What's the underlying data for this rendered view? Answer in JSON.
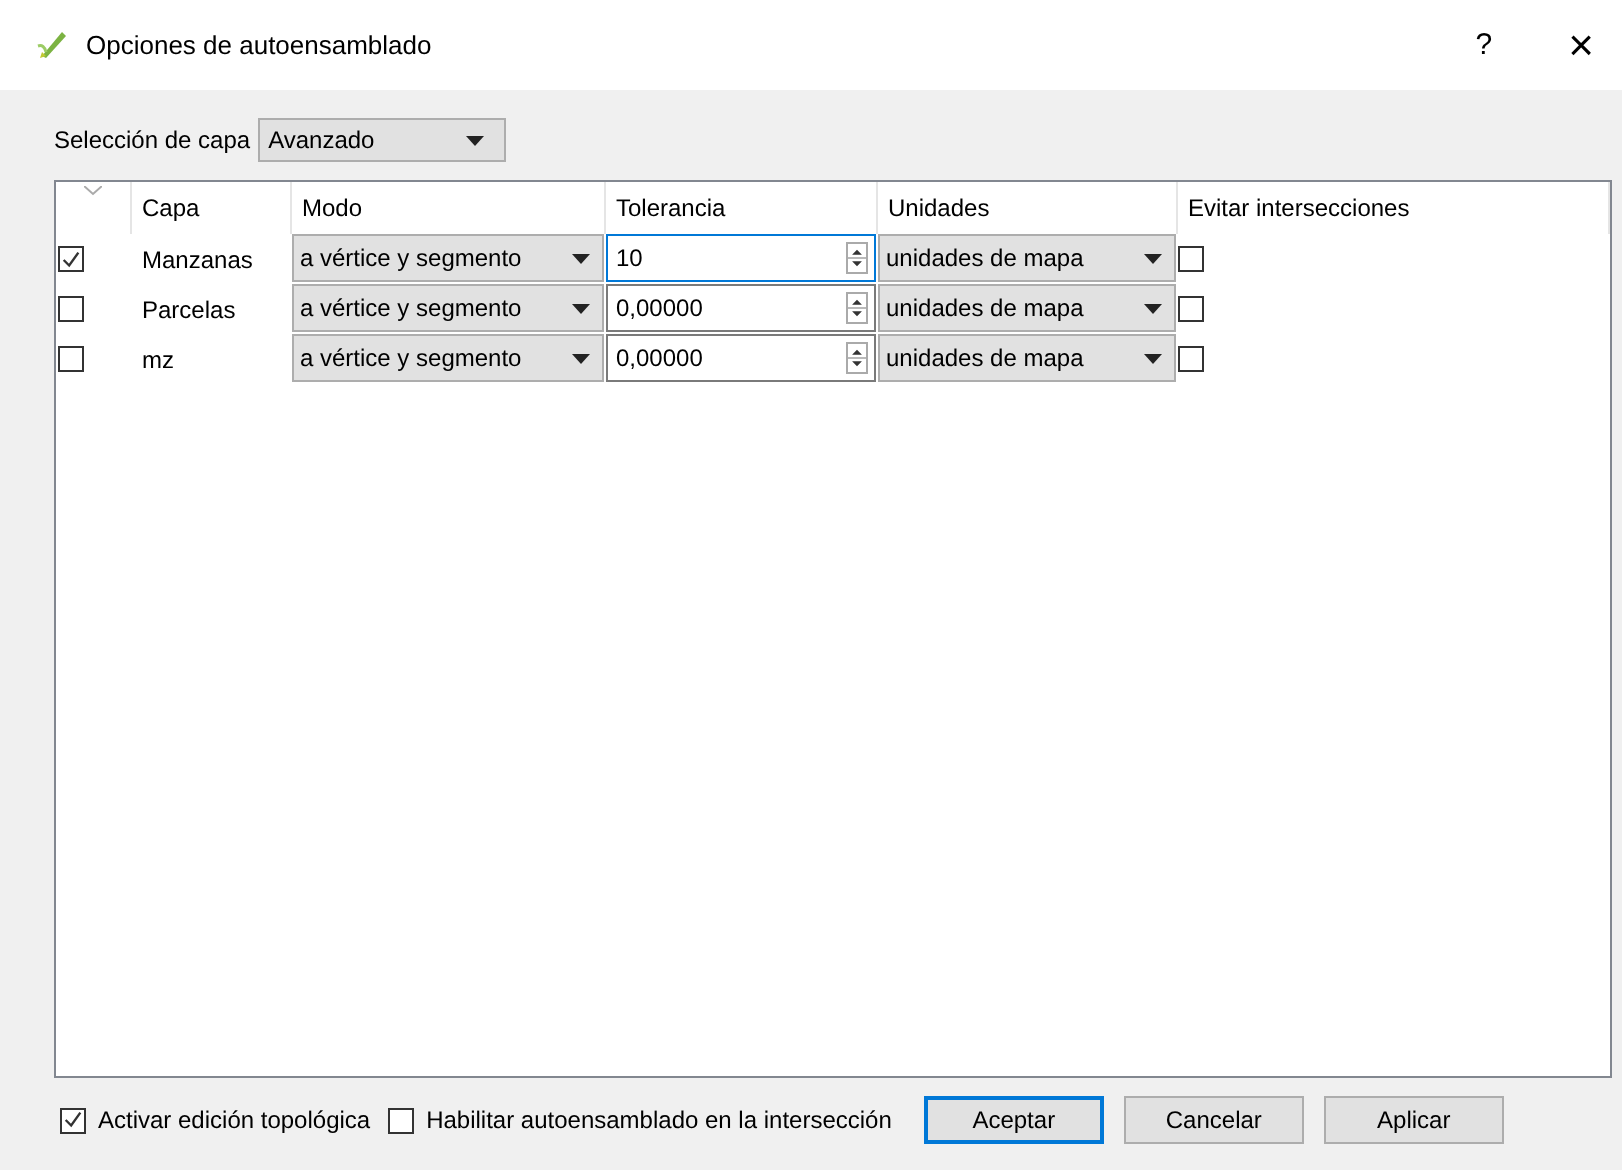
{
  "window": {
    "title": "Opciones de autoensamblado",
    "help": "?",
    "close": "×"
  },
  "layer_selection": {
    "label": "Selección de capa",
    "value": "Avanzado"
  },
  "table": {
    "columns": [
      "Capa",
      "Modo",
      "Tolerancia",
      "Unidades",
      "Evitar intersecciones"
    ],
    "rows": [
      {
        "checked": true,
        "layer": "Manzanas",
        "mode": "a vértice y segmento",
        "tolerance": "10",
        "focused": true,
        "units": "unidades de mapa",
        "avoid_intersections": false
      },
      {
        "checked": false,
        "layer": "Parcelas",
        "mode": "a vértice y segmento",
        "tolerance": "0,00000",
        "focused": false,
        "units": "unidades de mapa",
        "avoid_intersections": false
      },
      {
        "checked": false,
        "layer": "mz",
        "mode": "a vértice y segmento",
        "tolerance": "0,00000",
        "focused": false,
        "units": "unidades de mapa",
        "avoid_intersections": false
      }
    ]
  },
  "options": [
    {
      "label": "Activar edición topológica",
      "checked": true
    },
    {
      "label": "Habilitar autoensamblado en la intersección",
      "checked": false
    }
  ],
  "buttons": [
    {
      "label": "Aceptar",
      "default": true
    },
    {
      "label": "Cancelar",
      "default": false
    },
    {
      "label": "Aplicar",
      "default": false
    }
  ]
}
